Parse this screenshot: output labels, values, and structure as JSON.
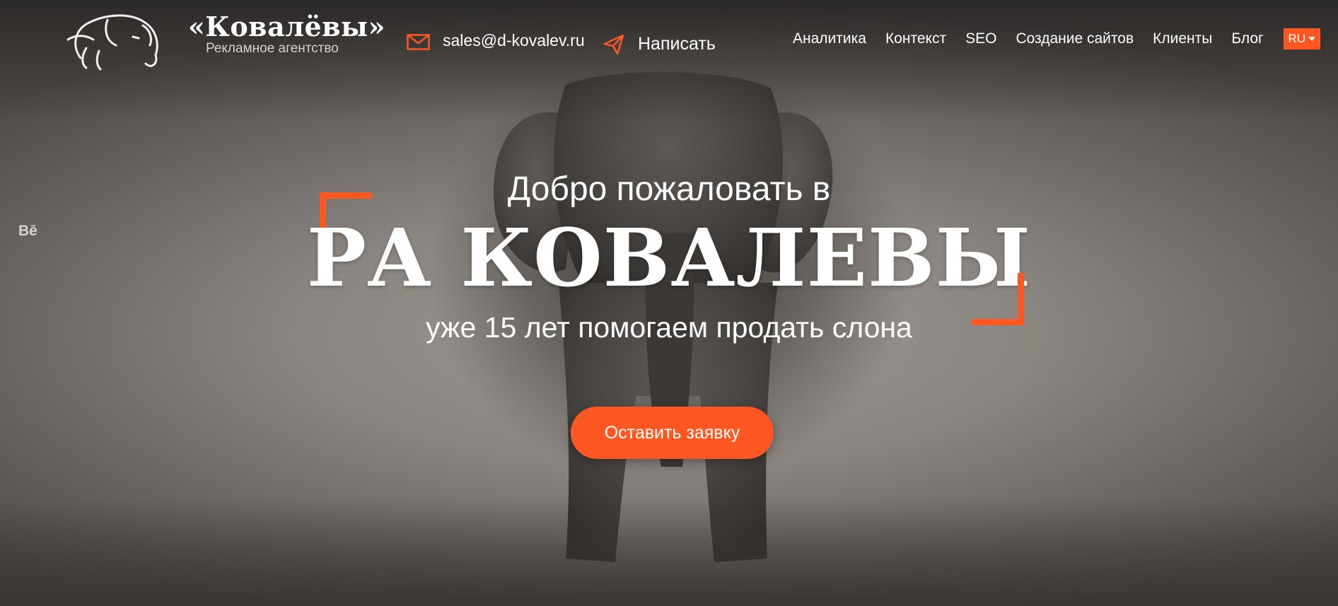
{
  "header": {
    "brand_name": "«Ковалёвы»",
    "tagline": "Рекламное агентство",
    "email": "sales@d-kovalev.ru",
    "write_label": "Написать",
    "nav": [
      "Аналитика",
      "Контекст",
      "SEO",
      "Создание сайтов",
      "Клиенты",
      "Блог"
    ],
    "language": "RU"
  },
  "social": {
    "behance_label": "Bē"
  },
  "hero": {
    "welcome": "Добро пожаловать в",
    "title": "РА КОВАЛЕВЫ",
    "subtitle": "уже 15 лет помогаем продать слона",
    "cta_label": "Оставить заявку"
  },
  "colors": {
    "accent": "#ff5722",
    "text": "#ffffff"
  },
  "icons": [
    "elephant-logo-icon",
    "mail-icon",
    "send-icon",
    "chevron-down-icon",
    "behance-icon"
  ]
}
